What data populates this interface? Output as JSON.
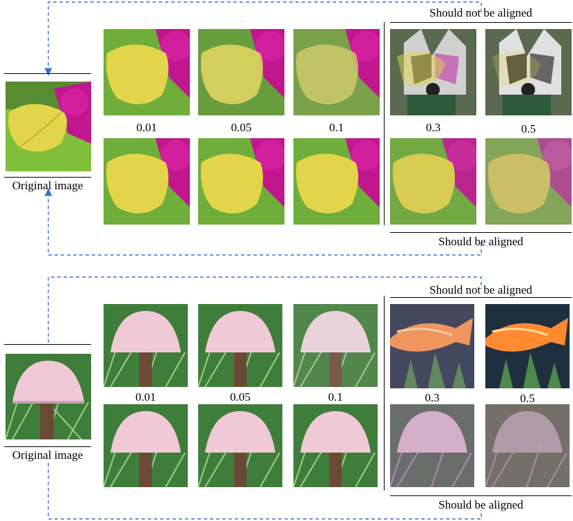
{
  "panels": [
    {
      "name": "butterfly",
      "original_label": "Original image",
      "top_header": "Should not be aligned",
      "bottom_header": "Should be aligned",
      "values": [
        "0.01",
        "0.05",
        "0.1",
        "0.3",
        "0.5"
      ]
    },
    {
      "name": "mushroom",
      "original_label": "Original image",
      "top_header": "Should not be aligned",
      "bottom_header": "Should be aligned",
      "values": [
        "0.01",
        "0.05",
        "0.1",
        "0.3",
        "0.5"
      ]
    }
  ],
  "colors": {
    "dashed_arrow": "#3d6fd0",
    "butterfly_wing": "#e3d54a",
    "flower": "#c0178f",
    "leaf": "#7fbf3a",
    "mushroom_cap": "#f0c9d6",
    "grass": "#3f7d3a",
    "fish": "#ff9a4a"
  }
}
